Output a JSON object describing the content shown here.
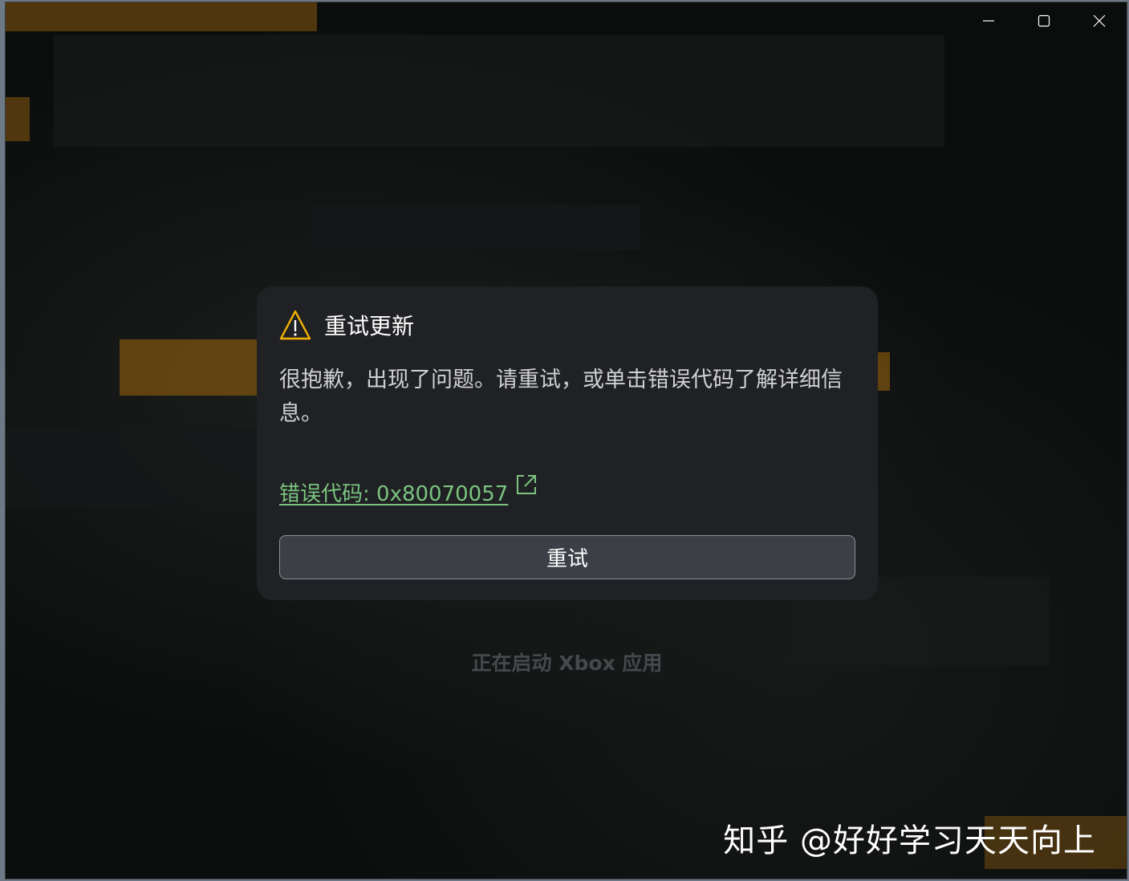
{
  "titlebar": {
    "minimize_icon": "minimize-icon",
    "maximize_icon": "maximize-icon",
    "close_icon": "close-icon"
  },
  "dialog": {
    "title": "重试更新",
    "warning_icon": "warning-icon",
    "warning_color": "#f5b400",
    "message": "很抱歉，出现了问题。请重试，或单击错误代码了解详细信息。",
    "error_code_label": "错误代码: 0x80070057",
    "error_link_color": "#7bc47f",
    "external_link_icon": "external-link-icon",
    "retry_label": "重试"
  },
  "status": {
    "text": "正在启动 Xbox 应用"
  },
  "watermark": {
    "text": "知乎 @好好学习天天向上"
  }
}
